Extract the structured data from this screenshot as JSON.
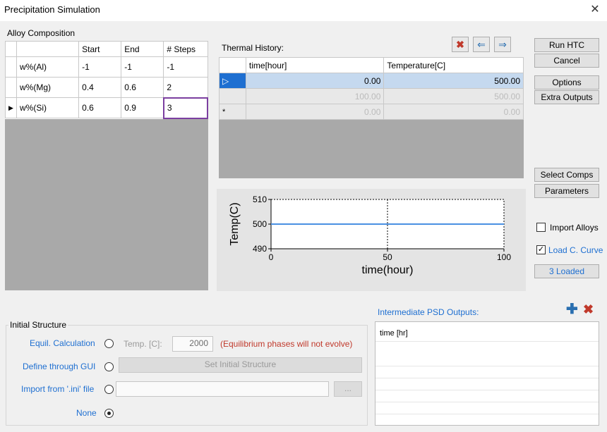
{
  "window": {
    "title": "Precipitation Simulation",
    "close_glyph": "✕"
  },
  "alloy": {
    "section_label": "Alloy Composition",
    "headers": [
      "Start",
      "End",
      "# Steps"
    ],
    "rows": [
      {
        "name": "w%(Al)",
        "start": "-1",
        "end": "-1",
        "steps": "-1"
      },
      {
        "name": "w%(Mg)",
        "start": "0.4",
        "end": "0.6",
        "steps": "2"
      },
      {
        "name": "w%(Si)",
        "start": "0.6",
        "end": "0.9",
        "steps": "3"
      }
    ]
  },
  "thermal": {
    "label": "Thermal History:",
    "headers": [
      "time[hour]",
      "Temperature[C]"
    ],
    "rows": [
      {
        "time": "0.00",
        "temp": "500.00"
      },
      {
        "time": "100.00",
        "temp": "500.00"
      },
      {
        "time": "0.00",
        "temp": "0.00"
      }
    ],
    "new_row_marker": "*",
    "current_row_marker": "▷"
  },
  "chart_data": {
    "type": "line",
    "xlabel": "time(hour)",
    "ylabel": "Temp(C)",
    "xlim": [
      0,
      100
    ],
    "ylim": [
      490,
      510
    ],
    "x_ticks": [
      "0",
      "50",
      "100"
    ],
    "y_ticks": [
      "510",
      "500",
      "490"
    ],
    "series": [
      {
        "x": [
          0,
          100
        ],
        "y": [
          500,
          500
        ],
        "color": "#4a90e2"
      }
    ]
  },
  "buttons": {
    "run_htc": "Run HTC",
    "cancel": "Cancel",
    "options": "Options",
    "extra_outputs": "Extra Outputs",
    "select_comps": "Select Comps",
    "parameters": "Parameters",
    "loaded": "3 Loaded",
    "set_initial_structure": "Set Initial Structure",
    "browse": "..."
  },
  "options": {
    "import_alloys": "Import Alloys",
    "load_curve": "Load C. Curve"
  },
  "initial_structure": {
    "group_label": "Initial Structure",
    "equil_label": "Equil. Calculation",
    "temp_label": "Temp. [C]:",
    "temp_value": "2000",
    "equil_note": "(Equilibrium phases will not evolve)",
    "gui_label": "Define through GUI",
    "ini_label": "Import from '.ini' file",
    "none_label": "None"
  },
  "psd": {
    "label": "Intermediate PSD Outputs:",
    "first_row": "time [hr]"
  },
  "colors": {
    "accent_blue": "#1e6fd1",
    "error_red": "#c0392b",
    "line_blue": "#4a90e2"
  }
}
